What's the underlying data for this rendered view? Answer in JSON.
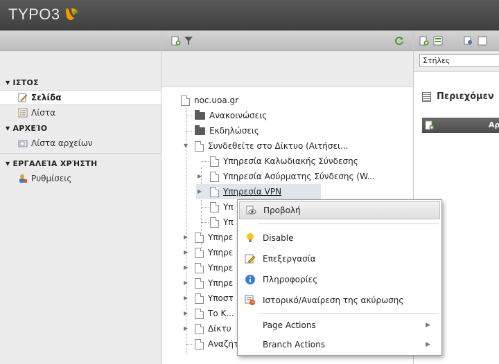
{
  "app": {
    "logo_text": "TYPO3"
  },
  "module_menu": {
    "sections": [
      {
        "title": "ΙΣΤΟΣ",
        "items": [
          {
            "label": "Σελίδα",
            "icon": "page-edit-icon",
            "active": true
          },
          {
            "label": "Λίστα",
            "icon": "list-icon"
          }
        ]
      },
      {
        "title": "ΑΡΧΕΊΟ",
        "items": [
          {
            "label": "Λίστα αρχείων",
            "icon": "filelist-icon"
          }
        ]
      },
      {
        "title": "ΕΡΓΑΛΕΊΑ ΧΡΉΣΤΗ",
        "items": [
          {
            "label": "Ρυθμίσεις",
            "icon": "user-settings-icon"
          }
        ]
      }
    ]
  },
  "page_tree": {
    "root": "noc.uoa.gr",
    "nodes": [
      "Ανακοινώσεις",
      "Εκδηλώσεις",
      "Συνδεθείτε στο Δίκτυο (Αιτήσει...",
      "Υπηρεσία Καλωδιακής Σύνδεσης",
      "Υπηρεσία Ασύρματης Σύνδεσης (W...",
      "Υπηρεσία VPN",
      "Υπ",
      "Υπ",
      "Υπηρε",
      "Υπηρε",
      "Υπηρε",
      "Υπηρε",
      "Υποστ",
      "Το Κ...",
      "Δίκτυ",
      "Αναζήτηση"
    ]
  },
  "content": {
    "columns_select": "Στήλες",
    "title": "Περιεχόμεν",
    "bar_label": "Αρ"
  },
  "context_menu": {
    "items": [
      {
        "label": "Προβολή",
        "icon": "view-icon"
      },
      {
        "label": "Disable",
        "icon": "lightbulb-icon"
      },
      {
        "label": "Επεξεργασία",
        "icon": "edit-pencil-icon"
      },
      {
        "label": "Πληροφορίες",
        "icon": "info-icon"
      },
      {
        "label": "Ιστορικό/Αναίρεση της ακύρωσης",
        "icon": "history-icon"
      },
      {
        "label": "Page Actions",
        "submenu": true
      },
      {
        "label": "Branch Actions",
        "submenu": true
      }
    ]
  },
  "colors": {
    "accent": "#f49700",
    "topbar": "#4a4a4a",
    "refresh": "#4a9a2a"
  }
}
